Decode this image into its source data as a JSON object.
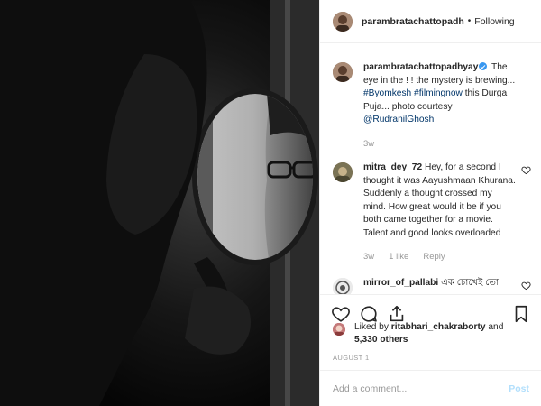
{
  "colors": {
    "verified": "#3897f0",
    "link": "#003569",
    "muted": "#999999",
    "post_disabled": "#b2dffc"
  },
  "photo": {
    "icon": "photo-mirror-reflection",
    "description_icon": "image"
  },
  "header": {
    "username": "parambratachattopadh",
    "separator": "•",
    "follow_label": "Following"
  },
  "caption": {
    "username": "parambratachattopadhyay",
    "text_1": " The eye in the ! ! the mystery is brewing...",
    "hashtags": "#Byomkesh #filmingnow",
    "text_2": " this Durga Puja... photo courtesy ",
    "mention": "@RudranilGhosh",
    "time": "3w"
  },
  "comments": [
    {
      "username": "mitra_dey_72",
      "text": " Hey, for a second I thought it was Aayushmaan Khurana. Suddenly a thought crossed my mind. How great would it be if you both came together for a movie. Talent and good looks overloaded",
      "time": "3w",
      "likes": "1 like",
      "reply": "Reply"
    },
    {
      "username": "mirror_of_pallabi",
      "text": " এক চোখেই তো"
    }
  ],
  "likes": {
    "prefix": "Liked by ",
    "user": "ritabhari_chakraborty",
    "middle": " and ",
    "others": "5,330 others"
  },
  "date": "AUGUST 1",
  "add_comment": {
    "placeholder": "Add a comment...",
    "post_label": "Post"
  }
}
